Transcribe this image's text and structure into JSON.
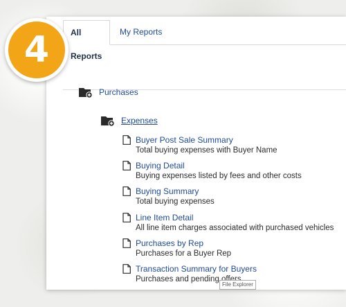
{
  "step_badge": "4",
  "tabs": [
    {
      "label": "All Reports",
      "active": true
    },
    {
      "label": "My Reports",
      "active": false
    }
  ],
  "folders": {
    "purchases": {
      "label": "Purchases",
      "icon": "folder-add-icon"
    },
    "expenses": {
      "label": "Expenses",
      "icon": "folder-add-icon"
    }
  },
  "reports": [
    {
      "title": "Buyer Post Sale Summary",
      "description": "Total buying expenses with Buyer Name",
      "icon": "document-icon"
    },
    {
      "title": "Buying Detail",
      "description": "Buying expenses listed by fees and other costs",
      "icon": "document-icon"
    },
    {
      "title": "Buying Summary",
      "description": "Total buying expenses",
      "icon": "document-icon"
    },
    {
      "title": "Line Item Detail",
      "description": "All line item charges associated with purchased vehicles",
      "icon": "document-icon"
    },
    {
      "title": "Purchases by Rep",
      "description": "Purchases for a Buyer Rep",
      "icon": "document-icon"
    },
    {
      "title": "Transaction Summary for Buyers",
      "description": "Purchases and pending offers",
      "icon": "document-icon"
    }
  ],
  "tooltip": "File Explorer",
  "colors": {
    "badge": "#f2a516",
    "link": "#1f4a9a",
    "text": "#2b2b2b"
  }
}
